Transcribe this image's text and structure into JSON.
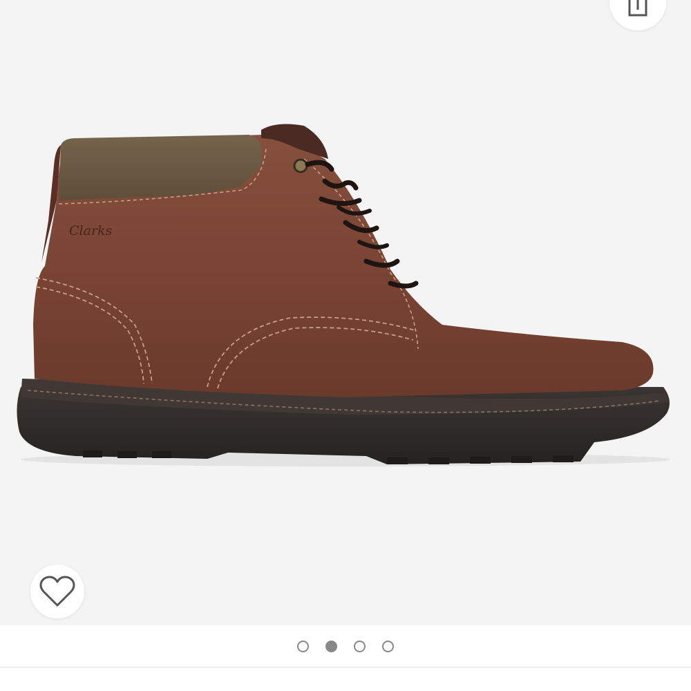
{
  "product": {
    "brand_logo_text": "Clarks"
  },
  "actions": {
    "share_icon": "share-icon",
    "wishlist_icon": "heart-outline-icon"
  },
  "gallery": {
    "total_images": 4,
    "active_index": 1
  },
  "colors": {
    "image_background": "#f4f4f4",
    "leather": "#7a4434",
    "suede_collar": "#6b5a43",
    "sole": "#2e2a28",
    "dot_color": "#888888",
    "icon_color": "#555555"
  }
}
